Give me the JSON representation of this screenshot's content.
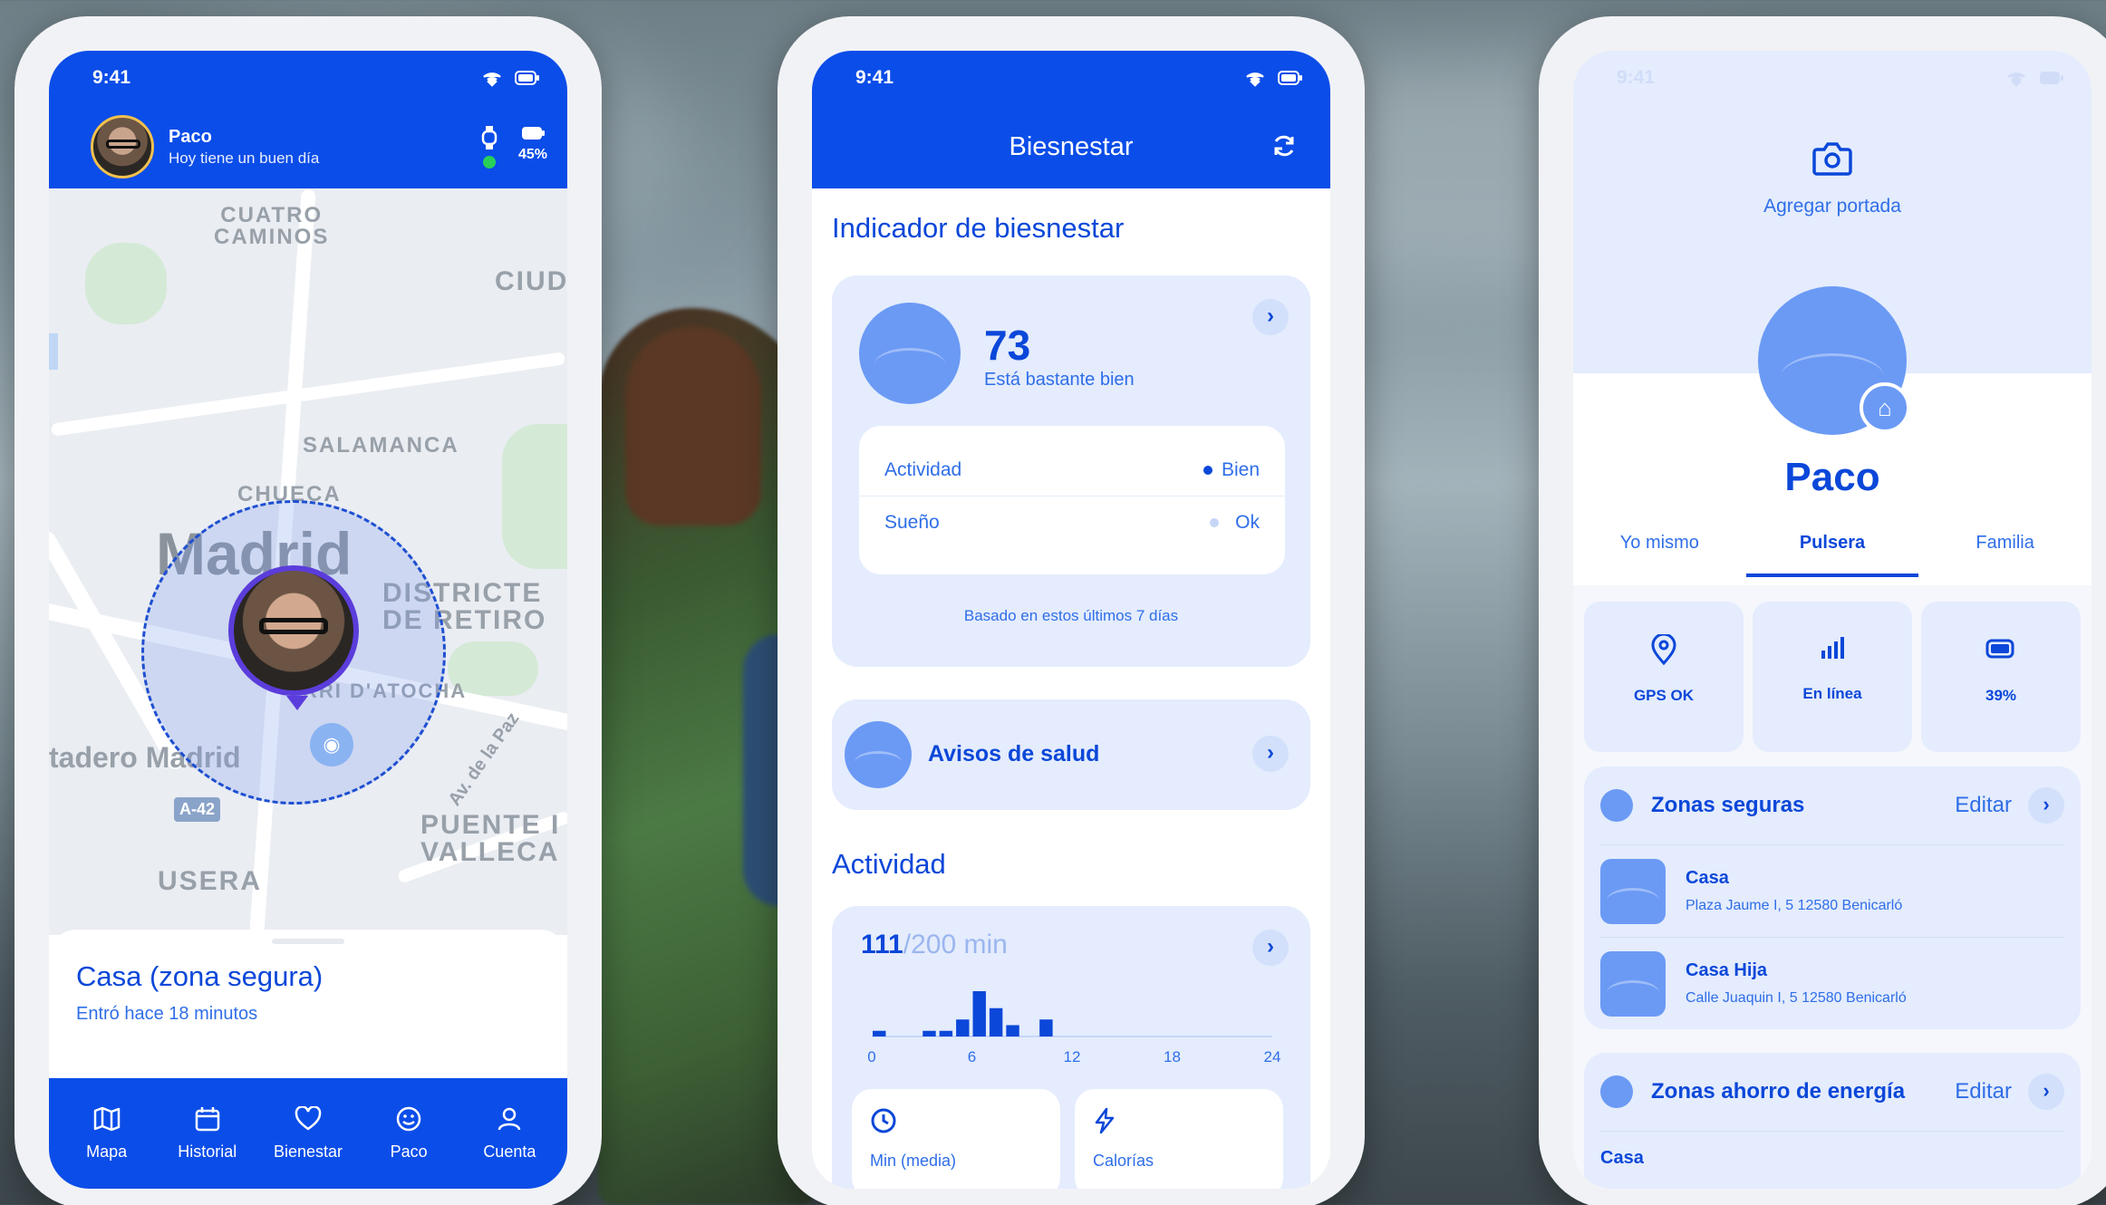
{
  "status": {
    "time": "9:41"
  },
  "phone1": {
    "user": {
      "name": "Paco",
      "subtitle": "Hoy tiene un buen día"
    },
    "battery": "45%",
    "map_labels": {
      "cuatro_caminos": "CUATRO\nCAMINOS",
      "ciudad": "CIUD",
      "salamanca": "SALAMANCA",
      "chueca": "CHUECA",
      "madrid": "Madrid",
      "retiro": "DISTRICTE\nDE RETIRO",
      "atocha": "RRI D'ATOCHA",
      "matadero": "tadero Madrid",
      "paz": "Av. de la Paz",
      "vallecas": "PUENTE I\nVALLECA",
      "usera": "USERA",
      "highway": "A-42"
    },
    "sheet": {
      "title": "Casa (zona segura)",
      "subtitle": "Entró hace 18 minutos"
    },
    "tabs": [
      {
        "icon": "map-icon",
        "label": "Mapa"
      },
      {
        "icon": "calendar-icon",
        "label": "Historial"
      },
      {
        "icon": "heart-icon",
        "label": "Bienestar"
      },
      {
        "icon": "smiley-icon",
        "label": "Paco"
      },
      {
        "icon": "user-icon",
        "label": "Cuenta"
      }
    ]
  },
  "phone2": {
    "title": "Biesnestar",
    "indicator_title": "Indicador de biesnestar",
    "score": "73",
    "score_text": "Está bastante bien",
    "rows": [
      {
        "label": "Actividad",
        "value": "Bien"
      },
      {
        "label": "Sueño",
        "value": "Ok"
      }
    ],
    "footnote": "Basado en estos últimos 7 días",
    "health": "Avisos de salud",
    "activity_title": "Actividad",
    "activity_value": "111",
    "activity_target": "/200 min",
    "chart_data": {
      "type": "bar",
      "categories": [
        "0",
        "1",
        "2",
        "3",
        "4",
        "5",
        "6",
        "7",
        "8",
        "9",
        "10",
        "11",
        "12",
        "13",
        "14",
        "15",
        "16",
        "17",
        "18",
        "19",
        "20",
        "21",
        "22",
        "23"
      ],
      "values": [
        1,
        0,
        0,
        1,
        1,
        3,
        8,
        5,
        2,
        0,
        3,
        0,
        0,
        0,
        0,
        0,
        0,
        0,
        0,
        0,
        0,
        0,
        0,
        0
      ],
      "tick_labels": [
        "0",
        "6",
        "12",
        "18",
        "24"
      ]
    },
    "minicards": [
      {
        "icon": "clock-icon",
        "label": "Min (media)"
      },
      {
        "icon": "lightning-icon",
        "label": "Calorías"
      }
    ]
  },
  "phone3": {
    "add_cover": "Agregar portada",
    "name": "Paco",
    "tabs": [
      "Yo mismo",
      "Pulsera",
      "Familia"
    ],
    "active_tab": "Pulsera",
    "tiles": [
      {
        "icon": "location-pin-icon",
        "label": "GPS OK"
      },
      {
        "icon": "signal-icon",
        "label": "En línea"
      },
      {
        "icon": "battery-icon",
        "label": "39%"
      }
    ],
    "safe_zones": {
      "title": "Zonas seguras",
      "edit": "Editar",
      "items": [
        {
          "name": "Casa",
          "address": "Plaza Jaume I, 5 12580 Benicarló"
        },
        {
          "name": "Casa Hija",
          "address": "Calle Juaquin I, 5 12580 Benicarló"
        }
      ]
    },
    "energy_zones": {
      "title": "Zonas ahorro de energía",
      "edit": "Editar",
      "first": "Casa"
    }
  }
}
